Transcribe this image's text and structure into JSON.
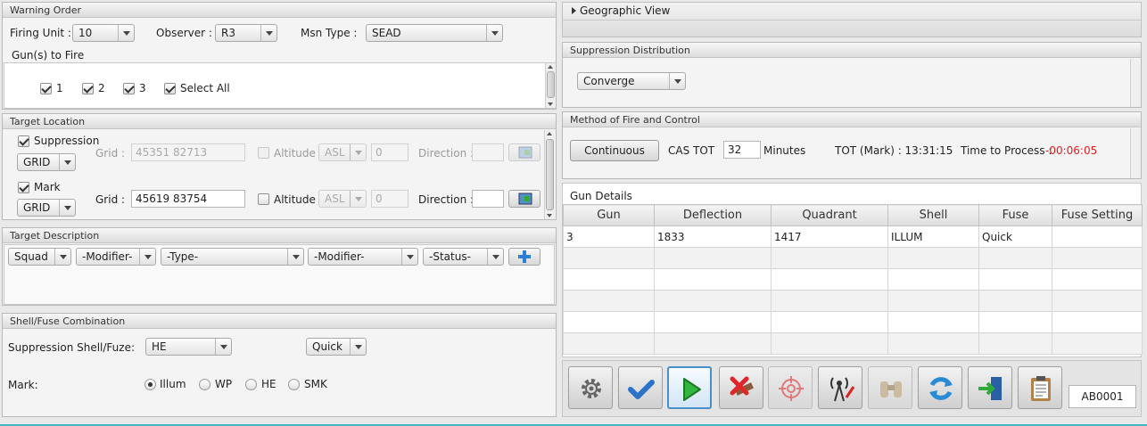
{
  "warning_order": {
    "title": "Warning Order",
    "firing_unit_label": "Firing Unit :",
    "firing_unit_value": "10",
    "observer_label": "Observer :",
    "observer_value": "R3",
    "msn_type_label": "Msn Type :",
    "msn_type_value": "SEAD",
    "guns_label": "Gun(s) to Fire",
    "guns": [
      {
        "label": "1",
        "checked": true
      },
      {
        "label": "2",
        "checked": true
      },
      {
        "label": "3",
        "checked": true
      }
    ],
    "select_all_label": "Select All"
  },
  "target_location": {
    "title": "Target Location",
    "suppression": {
      "label": "Suppression",
      "grid_type": "GRID",
      "grid_label": "Grid :",
      "grid_value": "45351 82713",
      "altitude_label": "Altitude",
      "altitude_ref": "ASL",
      "altitude_value": "0",
      "direction_label": "Direction :",
      "direction_value": ""
    },
    "mark": {
      "label": "Mark",
      "grid_type": "GRID",
      "grid_label": "Grid :",
      "grid_value": "45619 83754",
      "altitude_label": "Altitude",
      "altitude_ref": "ASL",
      "altitude_value": "0",
      "direction_label": "Direction :",
      "direction_value": ""
    }
  },
  "target_description": {
    "title": "Target Description",
    "squad": "Squad",
    "modifier1": "-Modifier-",
    "type": "-Type-",
    "modifier2": "-Modifier-",
    "status": "-Status-"
  },
  "shell_fuse": {
    "title": "Shell/Fuse Combination",
    "suppression_label": "Suppression Shell/Fuze:",
    "shell_value": "HE",
    "fuze_value": "Quick",
    "mark_label": "Mark:",
    "mark_options": [
      "Illum",
      "WP",
      "HE",
      "SMK"
    ],
    "mark_selected": "Illum"
  },
  "geographic_view": {
    "title": "Geographic View"
  },
  "suppression_distribution": {
    "title": "Suppression Distribution",
    "value": "Converge"
  },
  "method_of_fire": {
    "title": "Method of Fire and Control",
    "button_label": "Continuous",
    "cas_tot_label": "CAS TOT",
    "cas_tot_value": "32",
    "minutes_label": "Minutes",
    "tot_label": "TOT  (Mark) : 13:31:15",
    "time_to_process_label": "Time to Process :",
    "time_to_process_value": "-00:06:05",
    "time_color": "#e02020"
  },
  "gun_details": {
    "title": "Gun Details",
    "columns": [
      "Gun",
      "Deflection",
      "Quadrant",
      "Shell",
      "Fuse",
      "Fuse Setting"
    ],
    "rows": [
      [
        "3",
        "1833",
        "1417",
        "ILLUM",
        "Quick",
        ""
      ]
    ]
  },
  "toolbar": {
    "icons": [
      "gear-icon",
      "check-icon",
      "play-icon",
      "cancel-icon",
      "crosshair-icon",
      "antenna-icon",
      "binoculars-icon",
      "refresh-icon",
      "exit-icon",
      "clipboard-icon"
    ],
    "id_value": "AB0001"
  }
}
